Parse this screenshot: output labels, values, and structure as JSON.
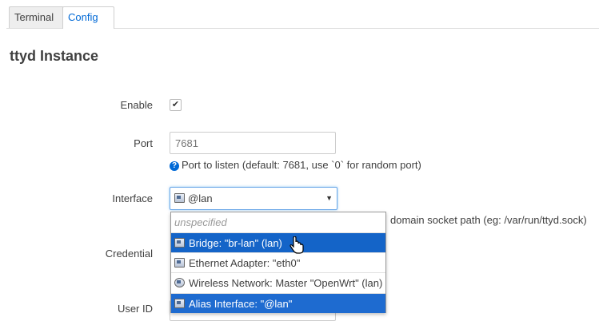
{
  "tabs": [
    {
      "label": "Terminal"
    },
    {
      "label": "Config"
    }
  ],
  "section_title": "ttyd Instance",
  "fields": {
    "enable": {
      "label": "Enable",
      "checked": true
    },
    "port": {
      "label": "Port",
      "placeholder": "7681",
      "help": "Port to listen (default: 7681, use `0` for random port)"
    },
    "interface": {
      "label": "Interface",
      "selected_value": "@lan",
      "help_visible_tail": "domain socket path (eg: /var/run/ttyd.sock)",
      "options": [
        {
          "label": "unspecified",
          "icon": "none"
        },
        {
          "label": "Bridge: \"br-lan\" (lan)",
          "icon": "bridge-icon"
        },
        {
          "label": "Ethernet Adapter: \"eth0\"",
          "icon": "ethernet-icon"
        },
        {
          "label": "Wireless Network: Master \"OpenWrt\" (lan)",
          "icon": "wireless-icon"
        },
        {
          "label": "Alias Interface: \"@lan\"",
          "icon": "alias-icon"
        }
      ]
    },
    "credential": {
      "label": "Credential"
    },
    "user_id": {
      "label": "User ID"
    }
  },
  "colors": {
    "accent": "#0069d6",
    "option_hover": "#1464c8",
    "option_selected": "#1e6bd0"
  }
}
